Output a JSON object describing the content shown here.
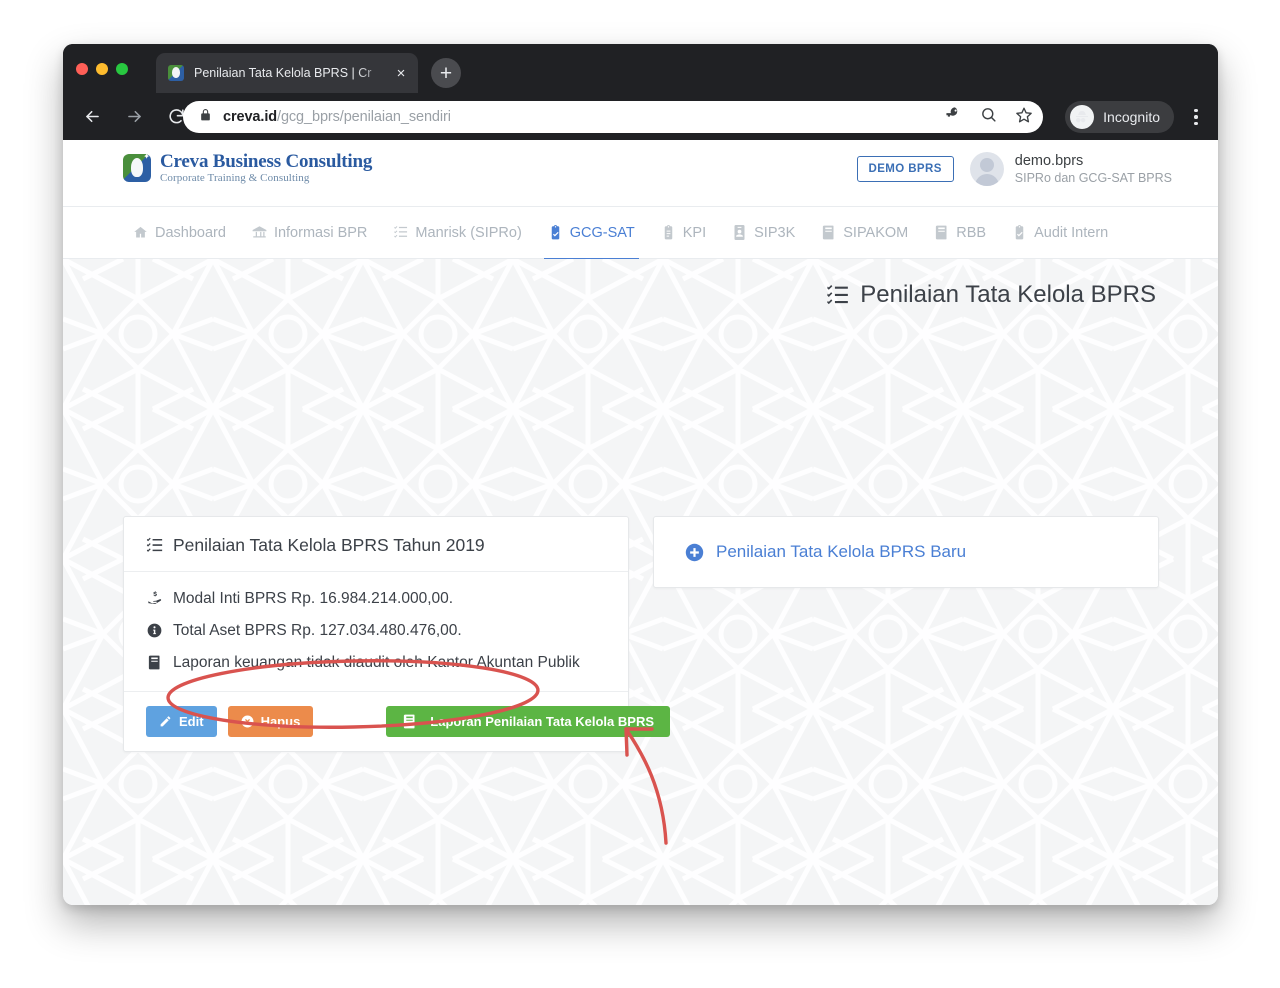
{
  "browser": {
    "tab_title": "Penilaian Tata Kelola BPRS | Cr",
    "close_label": "×",
    "new_tab_label": "+",
    "url_domain": "creva.id",
    "url_path": "/gcg_bprs/penilaian_sendiri",
    "profile_label": "Incognito",
    "icons": {
      "back": "back-arrow-icon",
      "forward": "forward-arrow-icon",
      "reload": "reload-icon",
      "lock": "lock-icon",
      "key": "password-key-icon",
      "zoom": "zoom-search-icon",
      "bookmark": "star-bookmark-icon",
      "incognito": "incognito-hat-icon",
      "menu": "kebab-menu-icon"
    }
  },
  "header": {
    "logo_main": "Creva Business Consulting",
    "logo_sub": "Corporate Training & Consulting",
    "demo_badge": "DEMO BPRS",
    "user_name": "demo.bprs",
    "user_role": "SIPRo dan GCG-SAT BPRS"
  },
  "nav": {
    "items": [
      {
        "label": "Dashboard",
        "icon": "home-icon",
        "active": false
      },
      {
        "label": "Informasi BPR",
        "icon": "bank-icon",
        "active": false
      },
      {
        "label": "Manrisk (SIPRo)",
        "icon": "tasks-list-icon",
        "active": false
      },
      {
        "label": "GCG-SAT",
        "icon": "clipboard-check-icon",
        "active": true
      },
      {
        "label": "KPI",
        "icon": "clipboard-icon",
        "active": false
      },
      {
        "label": "SIP3K",
        "icon": "id-badge-icon",
        "active": false
      },
      {
        "label": "SIPAKOM",
        "icon": "book-icon",
        "active": false
      },
      {
        "label": "RBB",
        "icon": "book-icon",
        "active": false
      },
      {
        "label": "Audit Intern",
        "icon": "clipboard-check-icon",
        "active": false
      }
    ]
  },
  "main": {
    "page_title": "Penilaian Tata Kelola BPRS",
    "page_title_icon": "tasks-list-icon",
    "card": {
      "title": "Penilaian Tata Kelola BPRS Tahun 2019",
      "title_icon": "tasks-list-icon",
      "info": [
        {
          "icon": "hand-holding-money-icon",
          "text": "Modal Inti BPRS Rp. 16.984.214.000,00."
        },
        {
          "icon": "info-circle-icon",
          "text": "Total Aset BPRS Rp. 127.034.480.476,00."
        },
        {
          "icon": "book-icon",
          "text": "Laporan keuangan tidak diaudit oleh Kantor Akuntan Publik"
        }
      ],
      "buttons": {
        "edit": "Edit",
        "edit_icon": "pencil-icon",
        "delete": "Hapus",
        "delete_icon": "times-circle-icon",
        "report": "Laporan Penilaian Tata Kelola BPRS",
        "report_icon": "book-icon"
      }
    },
    "side_card": {
      "label": "Penilaian Tata Kelola BPRS Baru",
      "icon": "plus-circle-icon"
    }
  },
  "annotation": {
    "color": "#d9534f",
    "shapes": [
      "highlight-ellipse",
      "pointer-arrow"
    ]
  },
  "colors": {
    "accent_blue": "#4a7fd4",
    "edit_blue": "#5fa2e0",
    "delete_orange": "#ec8b4b",
    "report_green": "#5cb544",
    "page_bg": "#f4f5f6",
    "annotation_red": "#d9534f"
  }
}
